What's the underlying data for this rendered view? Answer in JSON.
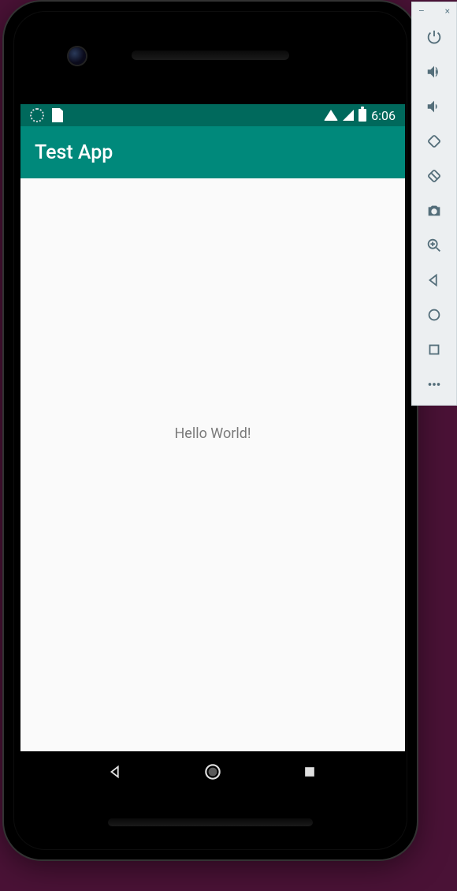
{
  "status_bar": {
    "time": "6:06"
  },
  "app_bar": {
    "title": "Test App"
  },
  "content": {
    "message": "Hello World!"
  },
  "emulator_toolbar": {
    "minimize": "–",
    "close": "×",
    "power": "power",
    "volume_up": "volume-up",
    "volume_down": "volume-down",
    "rotate_left": "rotate-left",
    "rotate_right": "rotate-right",
    "screenshot": "screenshot",
    "zoom": "zoom",
    "back": "back",
    "home": "home",
    "overview": "overview",
    "more": "more"
  }
}
